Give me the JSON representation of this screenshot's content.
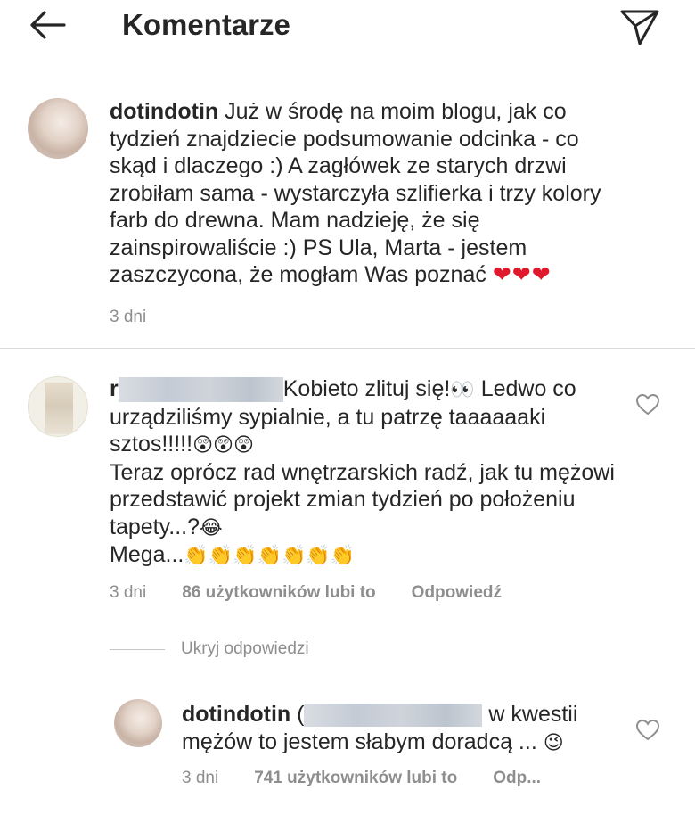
{
  "header": {
    "title": "Komentarze",
    "back_icon": "arrow-left-icon",
    "send_icon": "paper-plane-icon"
  },
  "main_comment": {
    "username": "dotindotin",
    "text": "Już w środę na moim blogu, jak co tydzień znajdziecie podsumowanie odcinka - co skąd i dlaczego :) A zagłówek ze starych drzwi zrobiłam sama - wystarczyła szlifierka i trzy kolory farb do drewna. Mam nadzieję, że się zainspirowaliście :) PS Ula, Marta - jestem zaszczycona, że mogłam Was poznać",
    "emoji": "❤❤❤",
    "time": "3 dni"
  },
  "comments": [
    {
      "username_initial": "r",
      "text_line1": "Kobieto zlituj się!",
      "eyes_emoji": "👀",
      "text_line1_cont": " Ledwo co urządziliśmy sypialnie, a tu patrzę taaaaaaki sztos!!!!!",
      "wow_emoji": "😲😲😲",
      "text_line2": "Teraz oprócz rad wnętrzarskich radź, jak tu mężowi przedstawić projekt zmian tydzień po położeniu tapety...?",
      "laugh_emoji": "😂",
      "text_line3": "Mega...",
      "clap_emoji": "👏👏👏👏👏👏👏",
      "time": "3 dni",
      "likes": "86 użytkowników lubi to",
      "reply_label": "Odpowiedź"
    }
  ],
  "replies_toggle": "Ukryj odpowiedzi",
  "reply": {
    "username": "dotindotin",
    "mention_prefix": "(",
    "text": " w kwestii mężów to jestem słabym doradcą ... ",
    "emoji": "😉",
    "time": "3 dni",
    "likes": "741 użytkowników lubi to",
    "reply_label": "Odp..."
  },
  "colors": {
    "text": "#262626",
    "muted": "#8e8e8e",
    "divider": "#dbdbdb",
    "heart": "#e0182b"
  }
}
